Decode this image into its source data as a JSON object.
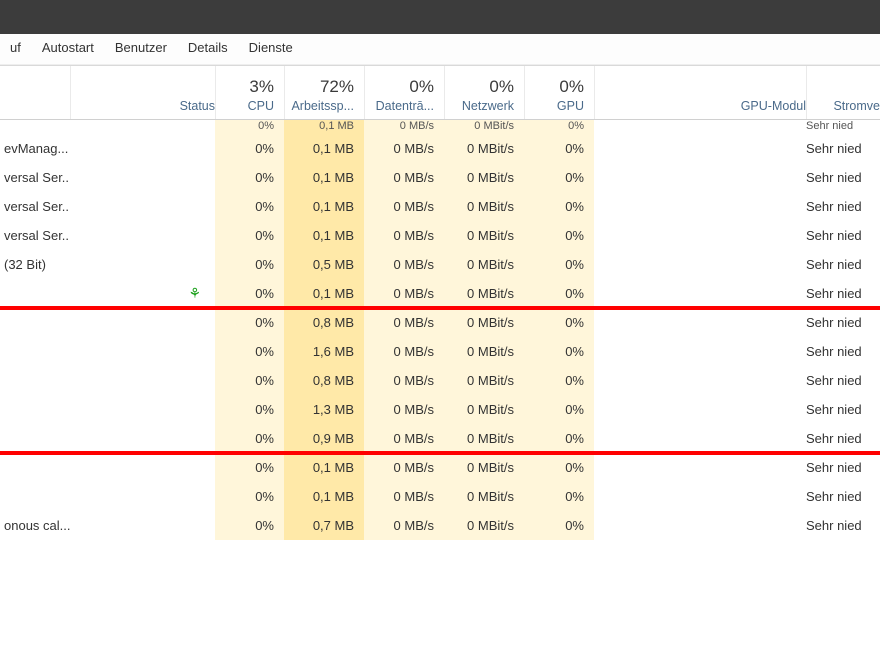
{
  "tabs": [
    "uf",
    "Autostart",
    "Benutzer",
    "Details",
    "Dienste"
  ],
  "columns": {
    "status_label": "Status",
    "cpu": {
      "pct": "3%",
      "label": "CPU"
    },
    "mem": {
      "pct": "72%",
      "label": "Arbeitssp..."
    },
    "disk": {
      "pct": "0%",
      "label": "Datentrā..."
    },
    "net": {
      "pct": "0%",
      "label": "Netzwerk"
    },
    "gpu": {
      "pct": "0%",
      "label": "GPU"
    },
    "gpumod": {
      "label": "GPU-Modul"
    },
    "power": {
      "label": "Stromve"
    }
  },
  "partial": {
    "cpu": "0%",
    "mem": "0,1 MB",
    "disk": "0 MB/s",
    "net": "0 MBit/s",
    "gpu": "0%",
    "power": "Sehr nied"
  },
  "rows": [
    {
      "name": "evManag...",
      "cpu": "0%",
      "mem": "0,1 MB",
      "disk": "0 MB/s",
      "net": "0 MBit/s",
      "gpu": "0%",
      "power": "Sehr nied"
    },
    {
      "name": "versal Ser...",
      "cpu": "0%",
      "mem": "0,1 MB",
      "disk": "0 MB/s",
      "net": "0 MBit/s",
      "gpu": "0%",
      "power": "Sehr nied"
    },
    {
      "name": "versal Ser...",
      "cpu": "0%",
      "mem": "0,1 MB",
      "disk": "0 MB/s",
      "net": "0 MBit/s",
      "gpu": "0%",
      "power": "Sehr nied"
    },
    {
      "name": "versal Ser...",
      "cpu": "0%",
      "mem": "0,1 MB",
      "disk": "0 MB/s",
      "net": "0 MBit/s",
      "gpu": "0%",
      "power": "Sehr nied"
    },
    {
      "name": "(32 Bit)",
      "cpu": "0%",
      "mem": "0,5 MB",
      "disk": "0 MB/s",
      "net": "0 MBit/s",
      "gpu": "0%",
      "power": "Sehr nied"
    },
    {
      "name": "",
      "leaf": true,
      "cpu": "0%",
      "mem": "0,1 MB",
      "disk": "0 MB/s",
      "net": "0 MBit/s",
      "gpu": "0%",
      "power": "Sehr nied"
    },
    {
      "name": "",
      "cpu": "0%",
      "mem": "0,8 MB",
      "disk": "0 MB/s",
      "net": "0 MBit/s",
      "gpu": "0%",
      "power": "Sehr nied",
      "section_start": true
    },
    {
      "name": "",
      "cpu": "0%",
      "mem": "1,6 MB",
      "disk": "0 MB/s",
      "net": "0 MBit/s",
      "gpu": "0%",
      "power": "Sehr nied"
    },
    {
      "name": "",
      "cpu": "0%",
      "mem": "0,8 MB",
      "disk": "0 MB/s",
      "net": "0 MBit/s",
      "gpu": "0%",
      "power": "Sehr nied"
    },
    {
      "name": "",
      "cpu": "0%",
      "mem": "1,3 MB",
      "disk": "0 MB/s",
      "net": "0 MBit/s",
      "gpu": "0%",
      "power": "Sehr nied"
    },
    {
      "name": "",
      "cpu": "0%",
      "mem": "0,9 MB",
      "disk": "0 MB/s",
      "net": "0 MBit/s",
      "gpu": "0%",
      "power": "Sehr nied",
      "section_end": true
    },
    {
      "name": "",
      "cpu": "0%",
      "mem": "0,1 MB",
      "disk": "0 MB/s",
      "net": "0 MBit/s",
      "gpu": "0%",
      "power": "Sehr nied"
    },
    {
      "name": "",
      "cpu": "0%",
      "mem": "0,1 MB",
      "disk": "0 MB/s",
      "net": "0 MBit/s",
      "gpu": "0%",
      "power": "Sehr nied"
    },
    {
      "name": "onous cal...",
      "cpu": "0%",
      "mem": "0,7 MB",
      "disk": "0 MB/s",
      "net": "0 MBit/s",
      "gpu": "0%",
      "power": "Sehr nied"
    }
  ]
}
